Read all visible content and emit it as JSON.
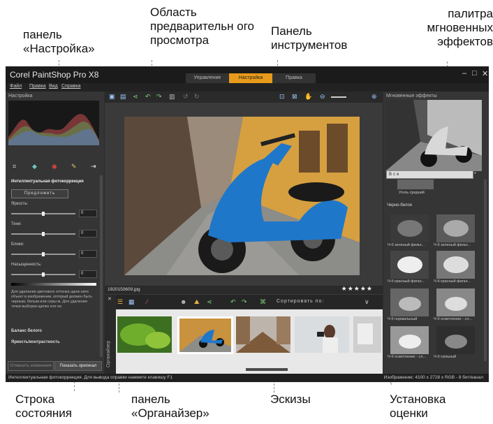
{
  "callouts": {
    "settings_panel": "панель «Настройка»",
    "preview_area": "Область предварительн ого просмотра",
    "tools_panel": "Панель инструментов",
    "instant_effects": "палитра мгновенных эффектов",
    "status_bar": "Строка состояния",
    "organizer_panel": "панель «Органайзер»",
    "thumbnails": "Эскизы",
    "rating": "Установка оценки"
  },
  "app": {
    "title": "Corel PaintShop Pro X8",
    "workspace_tabs": [
      "Управление",
      "Настройка",
      "Правка"
    ],
    "active_tab": "Настройка",
    "menu": [
      "Файл",
      "Правка",
      "Вид",
      "Справка"
    ]
  },
  "left_panel": {
    "header": "Настройка",
    "smart_photo_fix": "Интеллектуальная фотокоррекция",
    "suggest_button": "Предложить",
    "sliders": [
      {
        "label": "Яркость:",
        "value": "0",
        "level": 0.5
      },
      {
        "label": "Тени:",
        "value": "0",
        "level": 0.5
      },
      {
        "label": "Блики:",
        "value": "0",
        "level": 0.5
      },
      {
        "label": "Насыщенность:",
        "value": "0",
        "level": 0.5
      }
    ],
    "help_text": "Для удаления цветового оттенка щелк ните объект в изображении, который должен быть черным, белым или серы м. Для удаления точки выборки щелкн ите ее.",
    "sections": [
      "Баланс белого",
      "Яркость/контрастность"
    ],
    "reset_button": "Отменить изменения",
    "show_original_button": "Показать оригинал"
  },
  "center": {
    "file_name": "1920150609.jpg",
    "rating_stars": "★★★★★",
    "sort_label": "Сортировать по:",
    "organizer_label": "Органайзер"
  },
  "right_panel": {
    "title": "Мгновенные эффекты",
    "filter_value": "Все",
    "top_effect_label": "Уголь средний",
    "category": "Черно-белое",
    "effects": [
      "Ч-б зеленый фильт...",
      "Ч-б зеленый фильт...",
      "Ч-б красный фильт...",
      "Ч-б красный фильт...",
      "Ч-б нормальный",
      "Ч-б осветление - сл...",
      "Ч-б осветление - сл...",
      "Ч-б сильный"
    ]
  },
  "status": {
    "left": "Интеллектуальная фотокоррекция. Для вывода справки нажмите клавишу F1",
    "right": "Изображение: 4100 x 2728 x RGB - 8 бит/канал"
  },
  "colors": {
    "accent": "#e89a1a",
    "vespa_blue": "#1f77c9"
  }
}
